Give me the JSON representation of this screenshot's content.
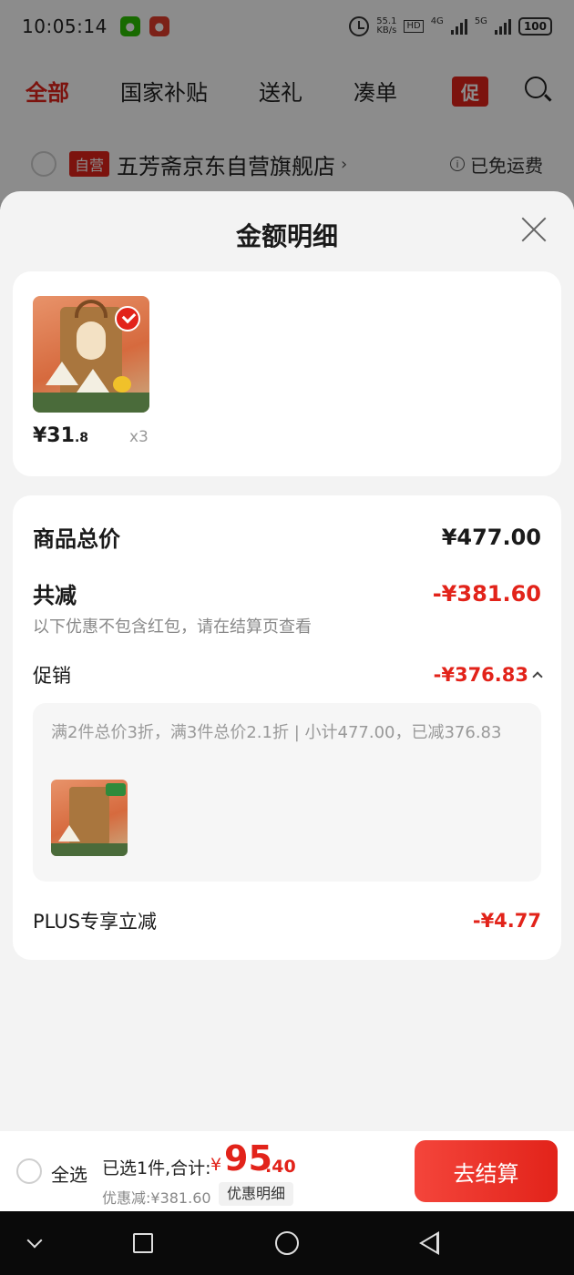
{
  "status_bar": {
    "time": "10:05:14",
    "net_speed": "55.1",
    "net_unit": "KB/s",
    "hd1": "HD",
    "signal1": "4G",
    "signal2": "5G",
    "battery": "100"
  },
  "top_tabs": [
    {
      "label": "全部",
      "active": true
    },
    {
      "label": "国家补贴"
    },
    {
      "label": "送礼"
    },
    {
      "label": "凑单"
    }
  ],
  "promo_tab": "促",
  "store": {
    "badge": "自营",
    "name": "五芳斋京东自营旗舰店",
    "arrow": "›",
    "shipping": "已免运费",
    "info": "i"
  },
  "sheet": {
    "title": "金额明细"
  },
  "product": {
    "price_int": "¥31",
    "price_dec": ".8",
    "qty": "x3"
  },
  "summary": {
    "total_label": "商品总价",
    "total_value": "¥477.00",
    "reduce_label": "共减",
    "reduce_value": "-¥381.60",
    "reduce_note": "以下优惠不包含红包，请在结算页查看",
    "promo_label": "促销",
    "promo_value": "-¥376.83",
    "promo_desc": "满2件总价3折，满3件总价2.1折 | 小计477.00，已减376.83",
    "plus_label": "PLUS专享立减",
    "plus_value": "-¥4.77"
  },
  "bottom_bar": {
    "select_all": "全选",
    "selected_text": "已选1件,合计:",
    "currency": "¥",
    "total_int": "95",
    "total_dec": ".40",
    "saved_text": "优惠减:¥381.60",
    "detail_button": "优惠明细",
    "checkout_button": "去结算"
  },
  "colors": {
    "accent": "#e2231a",
    "background": "#f3f3f3",
    "card": "#ffffff"
  },
  "icons": [
    "wechat-icon",
    "jd-app-icon",
    "alarm-icon",
    "search-icon",
    "close-icon",
    "check-icon",
    "chevron-up-icon",
    "info-icon",
    "nav-back-icon",
    "nav-home-icon",
    "nav-recent-icon",
    "nav-down-icon"
  ]
}
